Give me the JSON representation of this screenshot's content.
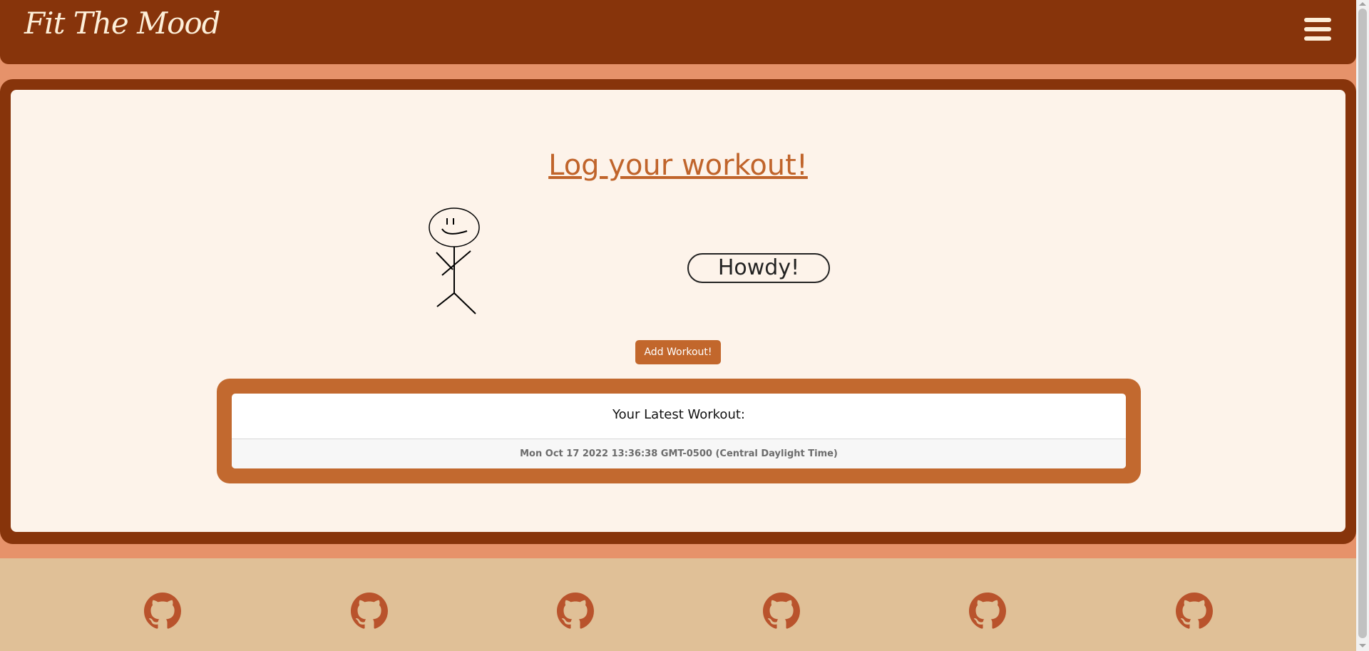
{
  "header": {
    "brand": "Fit The Mood",
    "menu_icon": "hamburger-menu-icon"
  },
  "main": {
    "title": "Log your workout!",
    "illustration_icon": "stick-figure-icon",
    "speech_bubble": "Howdy!",
    "add_button_label": "Add Workout!",
    "latest": {
      "heading": "Your Latest Workout:",
      "date": "Mon Oct 17 2022 13:36:38 GMT-0500 (Central Daylight Time)"
    }
  },
  "footer": {
    "links": [
      {
        "icon": "github-icon"
      },
      {
        "icon": "github-icon"
      },
      {
        "icon": "github-icon"
      },
      {
        "icon": "github-icon"
      },
      {
        "icon": "github-icon"
      },
      {
        "icon": "github-icon"
      }
    ]
  },
  "colors": {
    "header_bg": "#87340b",
    "page_bg": "#e6926a",
    "card_bg": "#fdf3ea",
    "accent": "#c2672c",
    "footer_bg": "#e0c097",
    "github_icon": "#b9532c"
  }
}
